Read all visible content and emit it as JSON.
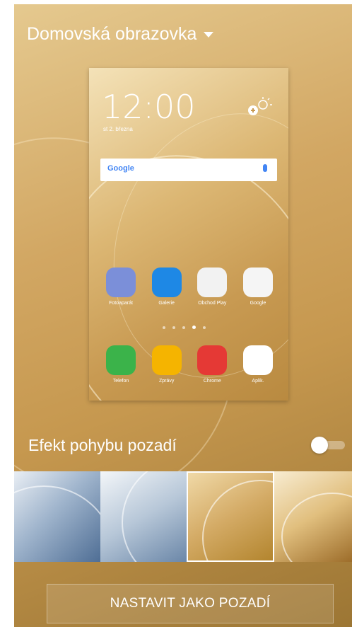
{
  "header": {
    "title": "Domovská obrazovka"
  },
  "preview": {
    "clock": "12:00",
    "date": "st 2. března",
    "search_logo": "Google",
    "apps": [
      {
        "label": "Fotoaparát",
        "icon": "camera-app-icon",
        "color": "#7b8fd9"
      },
      {
        "label": "Galerie",
        "icon": "gallery-app-icon",
        "color": "#1e88e5"
      },
      {
        "label": "Obchod Play",
        "icon": "play-store-icon",
        "color": "#f2f2f2"
      },
      {
        "label": "Google",
        "icon": "google-folder-icon",
        "color": "#f5f5f5"
      }
    ],
    "dock": [
      {
        "label": "Telefon",
        "icon": "phone-app-icon",
        "color": "#3bb34a"
      },
      {
        "label": "Zprávy",
        "icon": "messages-app-icon",
        "color": "#f5b400"
      },
      {
        "label": "Chrome",
        "icon": "chrome-app-icon",
        "color": "#e53935"
      },
      {
        "label": "Aplik.",
        "icon": "apps-grid-icon",
        "color": "#ffffff"
      }
    ],
    "page_dots": 5,
    "active_dot": 3
  },
  "motion_effect": {
    "label": "Efekt pohybu pozadí",
    "enabled": false
  },
  "wallpapers": [
    {
      "name": "blue-swirl-dark"
    },
    {
      "name": "blue-swirl-light"
    },
    {
      "name": "gold-swirl",
      "selected": true
    },
    {
      "name": "gold-ribbon"
    }
  ],
  "set_button": {
    "label": "NASTAVIT JAKO POZADÍ"
  }
}
